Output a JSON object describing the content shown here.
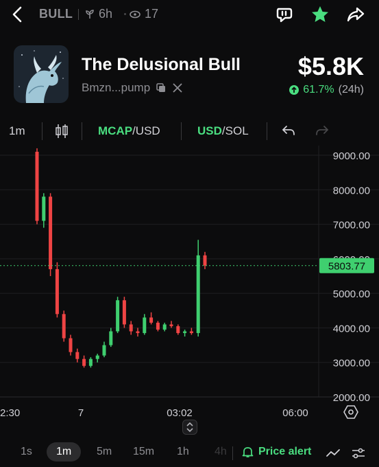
{
  "header": {
    "ticker": "BULL",
    "age": "6h",
    "views": "17"
  },
  "token": {
    "name": "The Delusional Bull",
    "address": "Bmzn...pump",
    "market_cap": "$5.8K",
    "change_pct": "61.7%",
    "change_period": "(24h)"
  },
  "toolbar": {
    "interval": "1m",
    "mcap_label": "MCAP",
    "usd_label": "/USD",
    "usd_accent": "USD",
    "sol_label": "/SOL"
  },
  "chart_data": {
    "type": "candlestick",
    "y_ticks": [
      "9000.00",
      "8000.00",
      "7000.00",
      "6000.00",
      "5000.00",
      "4000.00",
      "3000.00",
      "2000.00"
    ],
    "ylim": [
      2000,
      9000
    ],
    "x_ticks": [
      "2:30",
      "7",
      "03:02",
      "06:00"
    ],
    "current_price": "5803.77",
    "current_value": 5803.77,
    "candles": [
      {
        "o": 9100,
        "h": 9200,
        "l": 7000,
        "c": 7100
      },
      {
        "o": 7100,
        "h": 7900,
        "l": 6900,
        "c": 7800
      },
      {
        "o": 7800,
        "h": 7900,
        "l": 5500,
        "c": 5700
      },
      {
        "o": 5700,
        "h": 5900,
        "l": 4300,
        "c": 4400
      },
      {
        "o": 4400,
        "h": 4500,
        "l": 3600,
        "c": 3700
      },
      {
        "o": 3700,
        "h": 3800,
        "l": 3200,
        "c": 3300
      },
      {
        "o": 3300,
        "h": 3400,
        "l": 3000,
        "c": 3100
      },
      {
        "o": 3100,
        "h": 3200,
        "l": 2850,
        "c": 2900
      },
      {
        "o": 2900,
        "h": 3150,
        "l": 2850,
        "c": 3100
      },
      {
        "o": 3100,
        "h": 3250,
        "l": 3000,
        "c": 3200
      },
      {
        "o": 3200,
        "h": 3600,
        "l": 3150,
        "c": 3500
      },
      {
        "o": 3500,
        "h": 4000,
        "l": 3450,
        "c": 3900
      },
      {
        "o": 3900,
        "h": 4900,
        "l": 3850,
        "c": 4800
      },
      {
        "o": 4800,
        "h": 4900,
        "l": 4000,
        "c": 4100
      },
      {
        "o": 4100,
        "h": 4200,
        "l": 3800,
        "c": 3900
      },
      {
        "o": 3900,
        "h": 4000,
        "l": 3750,
        "c": 3850
      },
      {
        "o": 3850,
        "h": 4400,
        "l": 3800,
        "c": 4300
      },
      {
        "o": 4300,
        "h": 4450,
        "l": 4100,
        "c": 4150
      },
      {
        "o": 4150,
        "h": 4200,
        "l": 3900,
        "c": 3950
      },
      {
        "o": 3950,
        "h": 4150,
        "l": 3900,
        "c": 4100
      },
      {
        "o": 4100,
        "h": 4200,
        "l": 4000,
        "c": 4050
      },
      {
        "o": 4050,
        "h": 4100,
        "l": 3800,
        "c": 3850
      },
      {
        "o": 3850,
        "h": 3950,
        "l": 3750,
        "c": 3900
      },
      {
        "o": 3900,
        "h": 4000,
        "l": 3800,
        "c": 3850
      },
      {
        "o": 3850,
        "h": 6550,
        "l": 3750,
        "c": 6100
      },
      {
        "o": 6100,
        "h": 6200,
        "l": 5700,
        "c": 5803
      }
    ]
  },
  "intervals": [
    "1s",
    "1m",
    "5m",
    "15m",
    "1h",
    "4h"
  ],
  "active_interval": "1m",
  "price_alert_label": "Price alert",
  "colors": {
    "up": "#3fcf6f",
    "down": "#ef4444",
    "accent": "#4ade80",
    "background": "#0c0c0d"
  }
}
